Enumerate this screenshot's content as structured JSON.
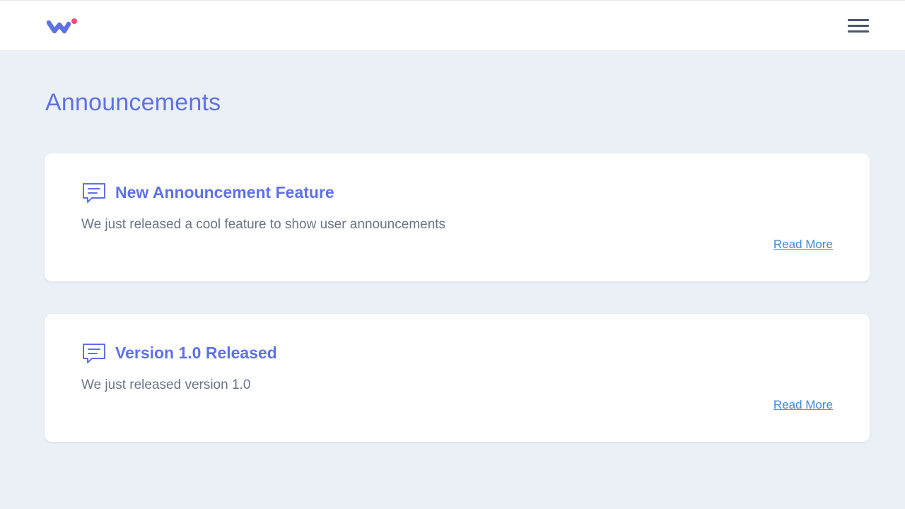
{
  "header": {
    "logo_icon": "brand-logo-icon",
    "menu_icon": "hamburger-menu-icon"
  },
  "page": {
    "title": "Announcements"
  },
  "announcements": [
    {
      "icon": "message-icon",
      "title": "New Announcement Feature",
      "body": "We just released a cool feature to show user announcements",
      "link_label": "Read More"
    },
    {
      "icon": "message-icon",
      "title": "Version 1.0 Released",
      "body": "We just released version 1.0",
      "link_label": "Read More"
    }
  ],
  "colors": {
    "accent": "#5e72e4",
    "logo_dot": "#f5487f",
    "link": "#3f8bd4",
    "background": "#ebf0f7"
  }
}
